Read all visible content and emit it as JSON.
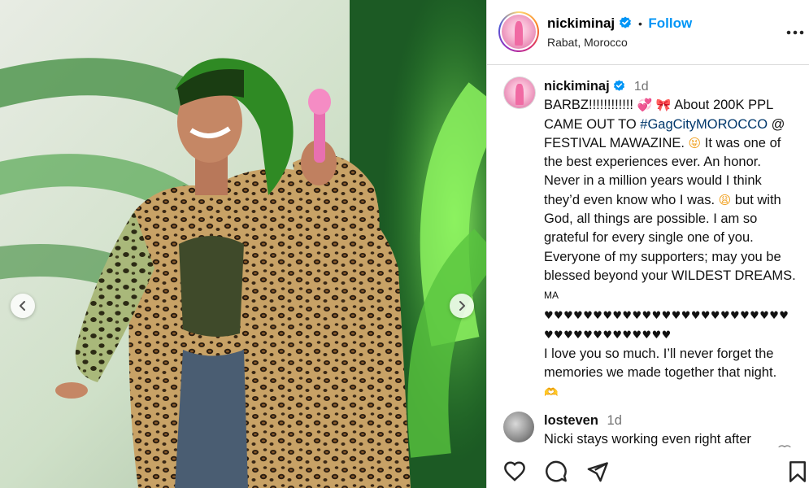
{
  "header": {
    "username": "nickiminaj",
    "separator": "•",
    "follow_label": "Follow",
    "location": "Rabat, Morocco",
    "more_icon": "more-horizontal-icon"
  },
  "caption": {
    "username": "nickiminaj",
    "time": "1d",
    "p1_a": "BARBZ!!!!!!!!!!!! ",
    "emoji_1": "💞",
    "emoji_2": "🎀",
    "p1_b": " About 200K PPL CAME OUT TO ",
    "hashtag": "#GagCityMOROCCO",
    "p1_c": " @ FESTIVAL MAWAZINE. ",
    "emoji_3": "😝",
    "p1_d": " It was one of the best experiences ever. An honor. Never in a million years would I think they’d even know who I was. ",
    "emoji_4": "😩",
    "p1_e": " but with God, all things are possible. I am so grateful for every single one of you. Everyone of my supporters; may you be blessed beyond your WILDEST DREAMS. ",
    "flag": "MA",
    "hearts_1": "♥♥♥♥♥♥♥♥♥♥♥♥♥♥♥♥♥♥♥♥♥♥♥♥♥",
    "hearts_2": "♥♥♥♥♥♥♥♥♥♥♥♥♥",
    "p2": "I love you so much. I’ll never forget the memories we made together that night.",
    "emoji_end": "🫶"
  },
  "comment": {
    "username": "losteven",
    "time": "1d",
    "text": "Nicki stays working even right after"
  },
  "media": {
    "prev_icon": "chevron-left-icon",
    "next_icon": "chevron-right-icon"
  },
  "actions": {
    "like_icon": "heart-icon",
    "comment_icon": "comment-icon",
    "share_icon": "share-icon",
    "save_icon": "bookmark-icon"
  },
  "colors": {
    "follow": "#0095f6",
    "hashtag": "#00376b",
    "verified": "#0095f6",
    "muted": "#737373",
    "border": "#dbdbdb"
  }
}
